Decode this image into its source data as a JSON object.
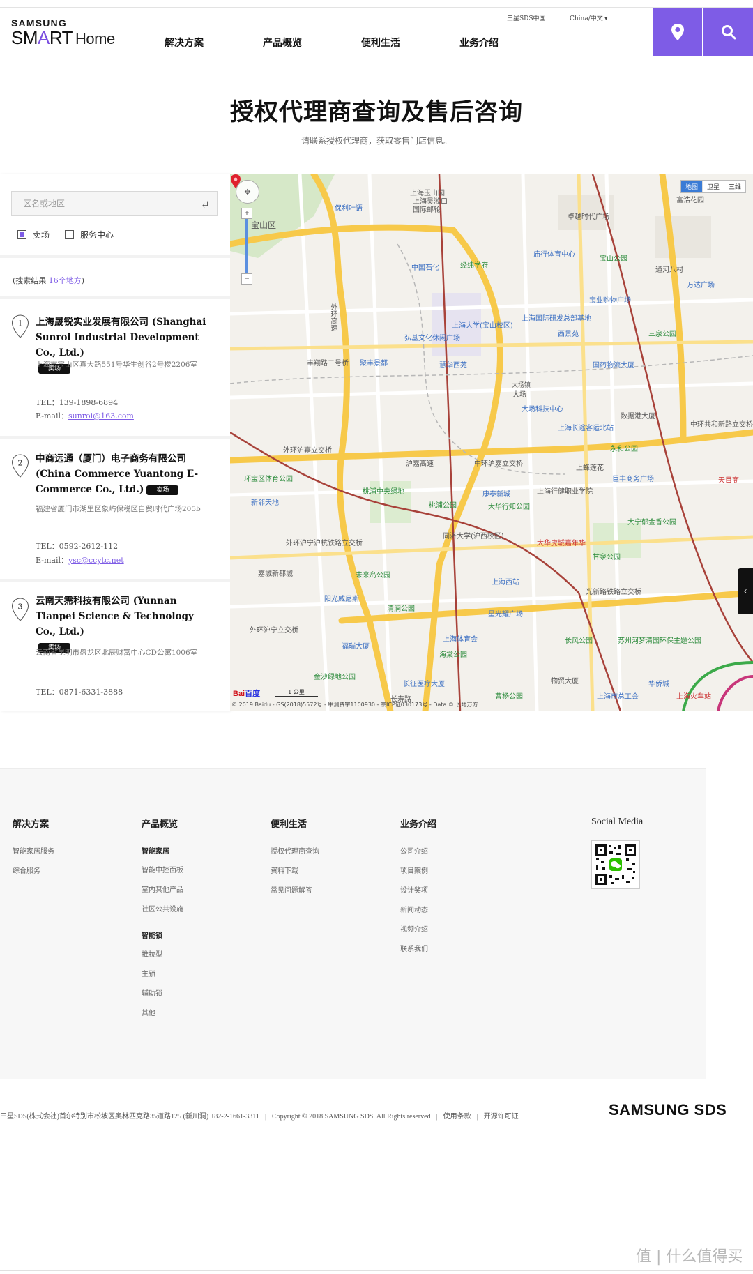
{
  "header": {
    "logo_top": "SAMSUNG",
    "logo_smart_1": "SM",
    "logo_smart_a": "A",
    "logo_smart_2": "RT",
    "logo_home": "Home",
    "nav": [
      "解决方案",
      "产品概览",
      "便利生活",
      "业务介绍"
    ],
    "util_sds": "三星SDS中国",
    "util_lang": "China/中文",
    "location_icon": "location-pin-icon",
    "search_icon": "search-icon"
  },
  "hero": {
    "title": "授权代理商查询及售后咨询",
    "subtitle": "请联系授权代理商，获取零售门店信息。"
  },
  "search": {
    "placeholder": "区名或地区",
    "enter_icon": "enter-icon",
    "filters": [
      {
        "label": "卖场",
        "checked": true
      },
      {
        "label": "服务中心",
        "checked": false
      }
    ]
  },
  "results": {
    "prefix": "(搜索结果 ",
    "count": "16个地方",
    "suffix": ")",
    "items": [
      {
        "num": "1",
        "name": "上海晟锐实业发展有限公司 (Shanghai Sunroi Industrial Development Co., Ltd.)",
        "tag": "卖场",
        "address": "上海市宝山区真大路551号华生创谷2号楼2206室",
        "tel": "TEL：139-1898-6894",
        "email_label": "E-mail：",
        "email": "sunroi@163.com"
      },
      {
        "num": "2",
        "name": "中商远通（厦门）电子商务有限公司 (China Commerce Yuantong E-Commerce Co., Ltd.)",
        "tag": "卖场",
        "address": "福建省厦门市湖里区象屿保税区自贸时代广场205b",
        "tel": "TEL：0592-2612-112",
        "email_label": "E-mail：",
        "email": "ysc@ccytc.net"
      },
      {
        "num": "3",
        "name": "云南天霈科技有限公司 (Yunnan Tianpei Science & Technology Co., Ltd.)",
        "tag": "卖场",
        "address": "云南省昆明市盘龙区北辰财富中心CD公寓1006室",
        "tel": "TEL：0871-6331-3888"
      }
    ]
  },
  "map": {
    "type_tabs": [
      "地图",
      "卫星",
      "三维"
    ],
    "scale": "1 公里",
    "copyright": "© 2019 Baidu - GS(2018)5572号 - 甲测资字1100930 - 京ICP证030173号 - Data © 长地万方",
    "baidu_1": "Bai",
    "baidu_2": "百度",
    "labels": [
      "上海玉山园",
      "保利叶语",
      "上海吴淞口",
      "国际邮轮",
      "卓越时代广场",
      "富浩花园",
      "宝山区",
      "中国石化",
      "庙行体育中心",
      "宝山公园",
      "万达广场",
      "通河八村",
      "经纬学府",
      "上海大学(宝山校区)",
      "上海国际研发总部基地",
      "宝业购物广场",
      "西景苑",
      "三泉公园",
      "弘基文化休闲广场",
      "慧华西苑",
      "丰翔路二号桥",
      "聚丰景都",
      "国药物流大厦",
      "大场",
      "外环高速",
      "大场镇",
      "大场科技中心",
      "上海长途客运北站",
      "永和公园",
      "数据港大厦",
      "中环共和新路立交桥",
      "外环沪嘉立交桥",
      "沪嘉高速",
      "中环沪嘉立交桥",
      "上蜂莲花",
      "巨丰商务广场",
      "环宝区体育公园",
      "桃浦中央绿地",
      "康泰新城",
      "上海行健职业学院",
      "大宁郁金香公园",
      "天目商",
      "新邻天地",
      "桃浦公园",
      "大华行知公园",
      "同济大学(沪西校区)",
      "大华虎城嘉年华",
      "甘泉公园",
      "外环沪宁沪杭铁路立交桥",
      "未来岛公园",
      "上海西站",
      "上海火车站",
      "嘉城新都城",
      "阳光威尼斯",
      "清涧公园",
      "星光耀广场",
      "光新路铁路立交桥",
      "外环沪宁立交桥",
      "福瑞大厦",
      "上海体育会",
      "长风公园",
      "海棠公园",
      "苏州河梦清园环保主题公园",
      "金沙绿地公园",
      "长征医疗大厦",
      "物贸大厦",
      "华侨城",
      "曹杨公园",
      "上海市总工会",
      "长寿路"
    ],
    "collapse_icon": "chevron-left-icon",
    "marker_icon": "map-marker-icon",
    "navigate_icon": "pan-control-icon",
    "zoom_in": "+",
    "zoom_out": "−"
  },
  "footer": {
    "columns": [
      {
        "title": "解决方案",
        "links": [
          "智能家居服务",
          "综合服务"
        ]
      },
      {
        "title": "产品概览",
        "groups": [
          {
            "sub": "智能家居",
            "links": [
              "智能中控面板",
              "室内其他产品",
              "社区公共设施"
            ]
          },
          {
            "sub": "智能锁",
            "links": [
              "推拉型",
              "主锁",
              "辅助锁",
              "其他"
            ]
          }
        ]
      },
      {
        "title": "便利生活",
        "links": [
          "授权代理商查询",
          "资料下载",
          "常见问题解答"
        ]
      },
      {
        "title": "业务介绍",
        "links": [
          "公司介绍",
          "项目案例",
          "设计奖项",
          "新闻动态",
          "视频介绍",
          "联系我们"
        ]
      }
    ],
    "social_title": "Social Media",
    "qr_icon": "wechat-qr-code-icon",
    "legal": {
      "address": "三星SDS(株式会社)首尔特别市松坡区奥林匹克路35道路125 (新川洞) +82-2-1661-3311",
      "copyright": "Copyright © 2018 SAMSUNG SDS. All Rights reserved",
      "terms": "使用条款",
      "license": "开源许可证",
      "sep": "|"
    },
    "sds_logo": "SAMSUNG SDS"
  },
  "watermark": "值 | 什么值得买",
  "colors": {
    "accent": "#7e5ce6",
    "tag_bg": "#111111",
    "map_road_major": "#f7c94a",
    "map_rail": "#b0392f"
  }
}
